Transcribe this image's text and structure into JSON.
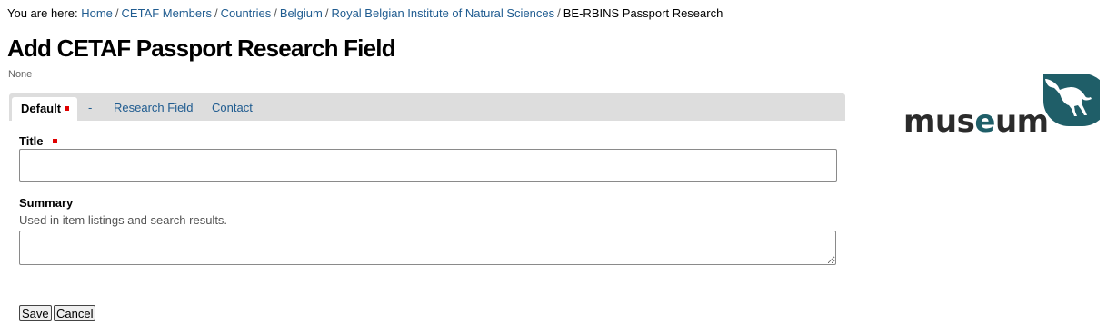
{
  "breadcrumb": {
    "prefix": "You are here:",
    "items": [
      {
        "label": "Home"
      },
      {
        "label": "CETAF Members"
      },
      {
        "label": "Countries"
      },
      {
        "label": "Belgium"
      },
      {
        "label": "Royal Belgian Institute of Natural Sciences"
      }
    ],
    "current": "BE-RBINS Passport Research"
  },
  "page": {
    "title": "Add CETAF Passport Research Field",
    "subtitle": "None"
  },
  "tabs": [
    {
      "label": "Default",
      "active": true,
      "required": true
    },
    {
      "label": "-"
    },
    {
      "label": "Research Field"
    },
    {
      "label": "Contact"
    }
  ],
  "form": {
    "title_label": "Title",
    "title_value": "",
    "summary_label": "Summary",
    "summary_help": "Used in item listings and search results.",
    "summary_value": ""
  },
  "buttons": {
    "save": "Save",
    "cancel": "Cancel"
  },
  "logo": {
    "text": "museum",
    "text_color": "#2b2b2b",
    "accent_color": "#1f5e68",
    "icon": "dinosaur-icon"
  },
  "colors": {
    "link": "#205c90",
    "required_marker": "#e00000",
    "tab_bar": "#dddddd"
  }
}
